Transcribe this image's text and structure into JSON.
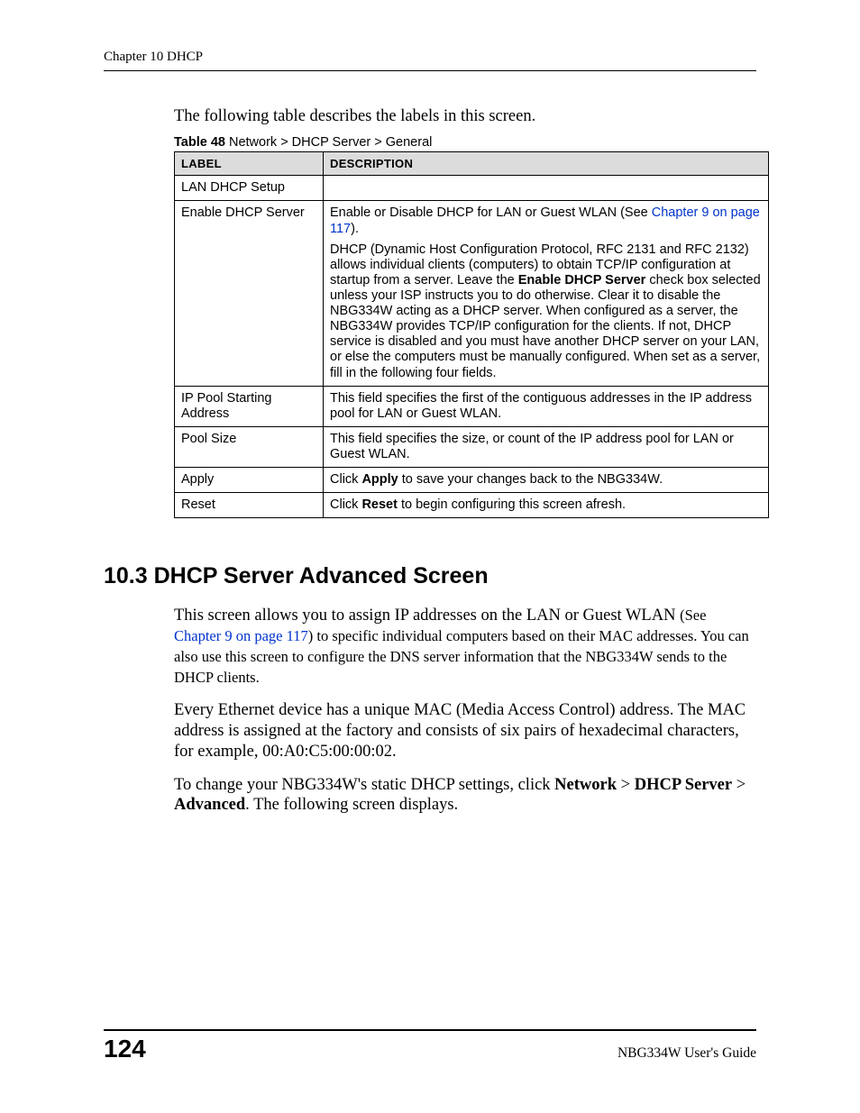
{
  "header": {
    "running_head": "Chapter 10 DHCP"
  },
  "intro": "The following table describes the labels in this screen.",
  "table": {
    "caption_label": "Table 48",
    "caption_rest": "   Network > DHCP Server > General",
    "head_label": "LABEL",
    "head_desc": "DESCRIPTION",
    "rows": {
      "r0": {
        "label": "LAN DHCP Setup",
        "desc": ""
      },
      "r1": {
        "label": "Enable DHCP Server",
        "desc_a": "Enable or Disable DHCP for LAN or Guest WLAN (See ",
        "desc_link": "Chapter 9 on page 117",
        "desc_b": ").",
        "desc_para2a": "DHCP (Dynamic Host Configuration Protocol, RFC 2131 and RFC 2132) allows individual clients (computers) to obtain TCP/IP configuration at startup from a server. Leave the ",
        "desc_para2_bold": "Enable DHCP Server",
        "desc_para2b": " check box selected unless your ISP instructs you to do otherwise. Clear it to disable the NBG334W acting as a DHCP server. When configured as a server, the NBG334W provides TCP/IP configuration for the clients. If not, DHCP service is disabled and you must have another DHCP server on your LAN, or else the computers must be manually configured. When set as a server, fill in the following four fields."
      },
      "r2": {
        "label": "IP Pool Starting Address",
        "desc": "This field specifies the first of the contiguous addresses in the IP address pool for LAN or Guest WLAN."
      },
      "r3": {
        "label": "Pool Size",
        "desc": "This field specifies the size, or count of the IP address pool for LAN or Guest WLAN."
      },
      "r4": {
        "label": "Apply",
        "desc_a": "Click ",
        "desc_bold": "Apply",
        "desc_b": " to save your changes back to the NBG334W."
      },
      "r5": {
        "label": "Reset",
        "desc_a": "Click ",
        "desc_bold": "Reset",
        "desc_b": " to begin configuring this screen afresh."
      }
    }
  },
  "section": {
    "heading": "10.3  DHCP Server Advanced Screen",
    "p1_a": "This screen allows you to assign IP addresses on the LAN or Guest WLAN ",
    "p1_see": "(See ",
    "p1_link": "Chapter 9 on page 117",
    "p1_b": ") to specific individual computers based on their MAC addresses. You can also use this screen to configure the DNS server information that the NBG334W sends to the DHCP clients.",
    "p2": "Every Ethernet device has a unique MAC (Media Access Control) address. The MAC address is assigned at the factory and consists of six pairs of hexadecimal characters, for example, 00:A0:C5:00:00:02.",
    "p3_a": "To change your NBG334W's static DHCP settings, click ",
    "p3_b1": "Network",
    "p3_sep1": " > ",
    "p3_b2": "DHCP Server",
    "p3_sep2": " > ",
    "p3_b3": "Advanced",
    "p3_c": ". The following screen displays."
  },
  "footer": {
    "page_number": "124",
    "guide": "NBG334W User's Guide"
  }
}
